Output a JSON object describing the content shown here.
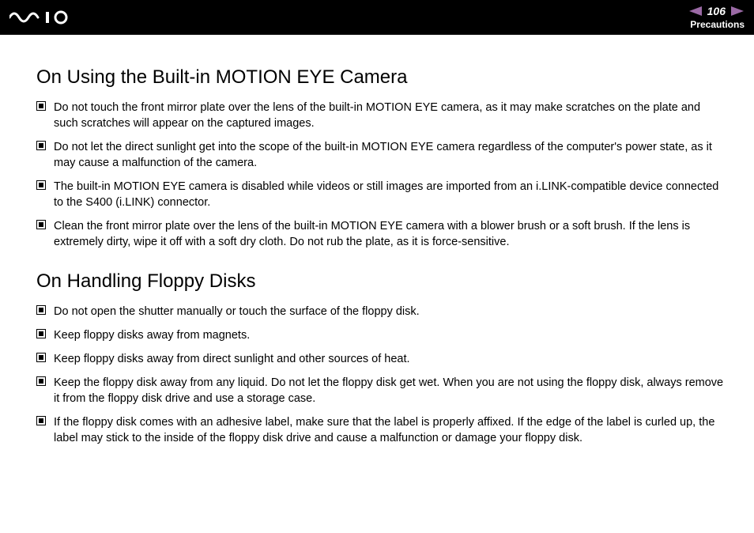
{
  "header": {
    "page_number": "106",
    "section": "Precautions"
  },
  "sections": [
    {
      "title": "On Using the Built-in MOTION EYE Camera",
      "items": [
        "Do not touch the front mirror plate over the lens of the built-in MOTION EYE camera, as it may make scratches on the plate and such scratches will appear on the captured images.",
        "Do not let the direct sunlight get into the scope of the built-in MOTION EYE camera regardless of the computer's power state, as it may cause a malfunction of the camera.",
        "The built-in MOTION EYE camera is disabled while videos or still images are imported from an i.LINK-compatible device connected to the S400 (i.LINK) connector.",
        "Clean the front mirror plate over the lens of the built-in MOTION EYE camera with a blower brush or a soft brush. If the lens is extremely dirty, wipe it off with a soft dry cloth. Do not rub the plate, as it is force-sensitive."
      ]
    },
    {
      "title": "On Handling Floppy Disks",
      "items": [
        "Do not open the shutter manually or touch the surface of the floppy disk.",
        "Keep floppy disks away from magnets.",
        "Keep floppy disks away from direct sunlight and other sources of heat.",
        "Keep the floppy disk away from any liquid. Do not let the floppy disk get wet. When you are not using the floppy disk, always remove it from the floppy disk drive and use a storage case.",
        "If the floppy disk comes with an adhesive label, make sure that the label is properly affixed. If the edge of the label is curled up, the label may stick to the inside of the floppy disk drive and cause a malfunction or damage your floppy disk."
      ]
    }
  ]
}
